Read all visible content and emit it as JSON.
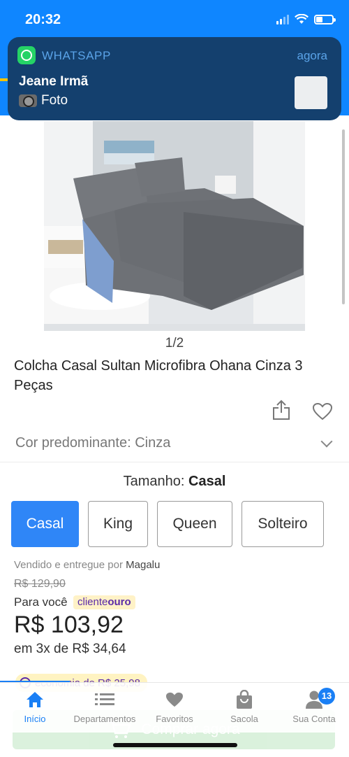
{
  "status_bar": {
    "time": "20:32"
  },
  "notification": {
    "app": "WHATSAPP",
    "time": "agora",
    "sender": "Jeane Irmã",
    "message": "Foto"
  },
  "product": {
    "pager": "1/2",
    "title": "Colcha Casal Sultan Microfibra Ohana Cinza 3 Peças",
    "color_label": "Cor predominante: Cinza"
  },
  "size": {
    "title_label": "Tamanho:",
    "title_value": "Casal",
    "options": [
      "Casal",
      "King",
      "Queen",
      "Solteiro"
    ],
    "selected": "Casal"
  },
  "pricing": {
    "seller_prefix": "Vendido e entregue por",
    "seller_name": "Magalu",
    "old_price": "R$ 129,90",
    "para_voce": "Para você",
    "badge_light": "cliente",
    "badge_bold": "ouro",
    "price": "R$ 103,92",
    "installments": "em 3x de R$ 34,64",
    "economy": "economia de R$ 25,98"
  },
  "buy_button": {
    "label": "Comprar agora"
  },
  "bottom_nav": {
    "items": [
      {
        "label": "Início",
        "icon": "home-icon"
      },
      {
        "label": "Departamentos",
        "icon": "list-icon"
      },
      {
        "label": "Favoritos",
        "icon": "heart-icon"
      },
      {
        "label": "Sacola",
        "icon": "bag-icon"
      },
      {
        "label": "Sua Conta",
        "icon": "user-icon"
      }
    ],
    "account_badge": "13"
  },
  "colors": {
    "brand_blue": "#0f86ff",
    "selected_size": "#2f86f7",
    "notification_bg": "#14406e",
    "whatsapp_green": "#25d366"
  }
}
